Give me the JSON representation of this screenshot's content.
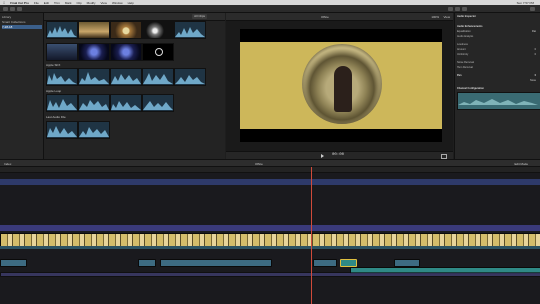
{
  "menubar": {
    "apple": "",
    "items": [
      "Final Cut Pro",
      "File",
      "Edit",
      "Trim",
      "Mark",
      "Clip",
      "Modify",
      "View",
      "Window",
      "Help"
    ],
    "right_text": "Sun 7:57 PM"
  },
  "sidebar": {
    "items": [
      "Library",
      "Smart Collections",
      "7-28-18"
    ]
  },
  "browser": {
    "filter_label": "All Clips",
    "section_apple_sfx": "Apple SFX",
    "section_apple_loop": "Apple Loop",
    "section_last_audio": "Last Audio File"
  },
  "viewer": {
    "title": "Office",
    "zoom": "100%",
    "view_label": "View",
    "timecode": "00:00"
  },
  "inspector": {
    "title": "Audio Inspector",
    "rows": [
      "Audio Enhancements",
      "Equalization",
      "Audio Analysis",
      "Loudness",
      "Amount",
      "Uniformity",
      "Noise Removal",
      "Hum Removal",
      "Pan",
      "Channel Configuration"
    ],
    "equalization_value": "Flat",
    "amount_value": "0",
    "uniformity_value": "0",
    "pan_value": "0",
    "mode_value": "None"
  },
  "midbar": {
    "left_label": "Index",
    "center_label": "Office",
    "right_label": "Edit Mode"
  }
}
